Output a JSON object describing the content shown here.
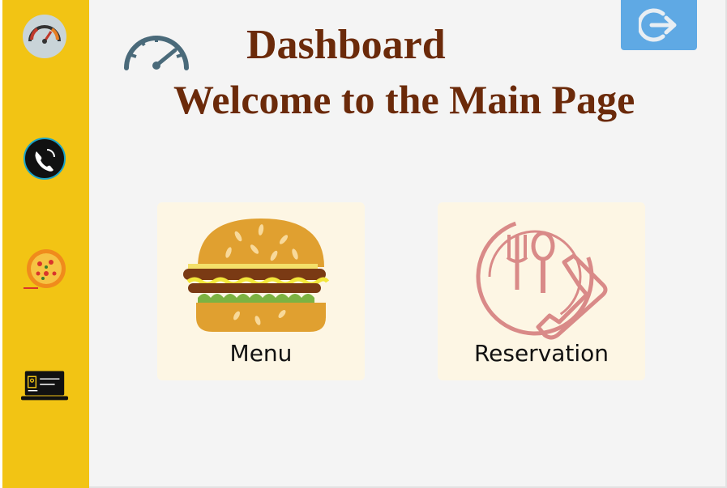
{
  "header": {
    "title": "Dashboard",
    "subtitle": "Welcome to the Main Page"
  },
  "sidebar": {
    "items": [
      {
        "name": "dashboard",
        "icon": "speedometer-icon"
      },
      {
        "name": "contact",
        "icon": "phone-icon"
      },
      {
        "name": "menu",
        "icon": "pizza-icon"
      },
      {
        "name": "reservation",
        "icon": "laptop-icon"
      }
    ]
  },
  "logout": {
    "icon": "logout-icon"
  },
  "cards": [
    {
      "label": "Menu",
      "icon": "burger-icon"
    },
    {
      "label": "Reservation",
      "icon": "dining-phone-icon"
    }
  ],
  "colors": {
    "sidebar": "#f2c414",
    "title": "#6b2a0a",
    "logout_button": "#5fa9e4",
    "card_background": "#fdf6e4",
    "page_background": "#f4f4f4"
  }
}
